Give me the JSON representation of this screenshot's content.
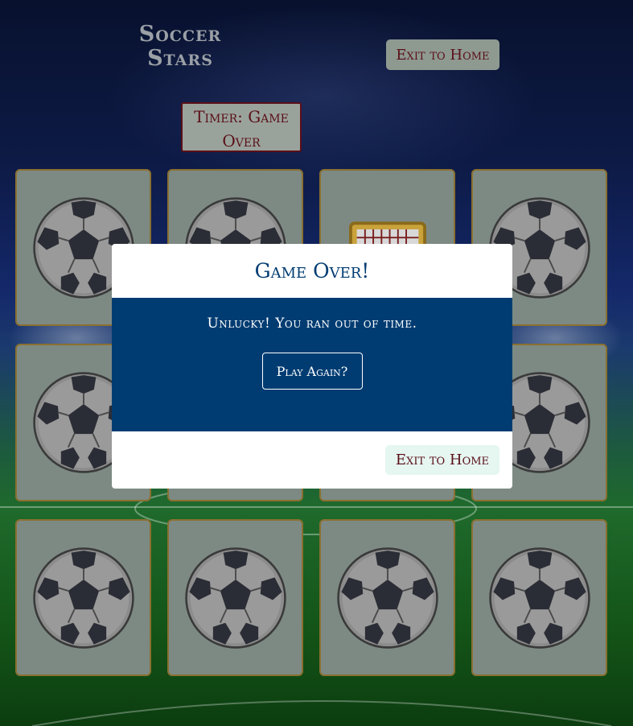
{
  "header": {
    "title_line1": "Soccer",
    "title_line2": "Stars",
    "exit_label": "Exit to Home",
    "timer_text": "Timer: Game Over"
  },
  "board": {
    "rows": 3,
    "cols": 4,
    "cards": [
      {
        "face": "soccer-ball"
      },
      {
        "face": "soccer-ball"
      },
      {
        "face": "goal"
      },
      {
        "face": "soccer-ball"
      },
      {
        "face": "soccer-ball"
      },
      {
        "face": "soccer-ball"
      },
      {
        "face": "soccer-ball"
      },
      {
        "face": "soccer-ball"
      },
      {
        "face": "soccer-ball"
      },
      {
        "face": "soccer-ball"
      },
      {
        "face": "soccer-ball"
      },
      {
        "face": "soccer-ball"
      }
    ]
  },
  "modal": {
    "title": "Game Over!",
    "message": "Unlucky! You ran out of time.",
    "play_again_label": "Play Again?",
    "exit_label": "Exit to Home"
  },
  "colors": {
    "accent": "#003c72",
    "maroon": "#5a0f18",
    "card": "#7d8a84"
  }
}
